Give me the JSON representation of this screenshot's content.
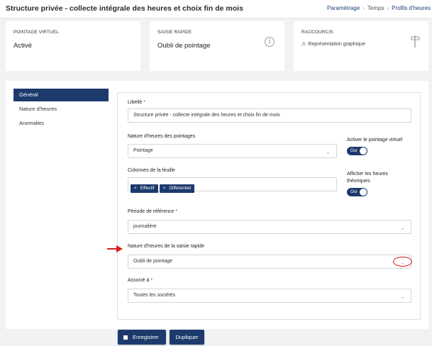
{
  "header": {
    "title": "Structure privée - collecte intégrale des heures et choix fin de mois",
    "breadcrumbs": [
      "Paramétrage",
      "Temps",
      "Profils d'heures"
    ]
  },
  "cards": {
    "pointage_virtuel": {
      "label": "POINTAGE VIRTUEL",
      "value": "Activé"
    },
    "saisie_rapide": {
      "label": "SAISIE RAPIDE",
      "value": "Oubli de pointage",
      "icon": "info-icon"
    },
    "raccourcis": {
      "label": "RACCOURCIS",
      "link_icon": "warning-icon",
      "link": "Représentation graphique",
      "icon": "signpost-icon"
    }
  },
  "nav": {
    "items": [
      {
        "label": "Général",
        "active": true
      },
      {
        "label": "Nature d'heures",
        "active": false
      },
      {
        "label": "Anomalies",
        "active": false
      }
    ]
  },
  "form": {
    "libelle": {
      "label": "Libellé",
      "required": "*",
      "value": "Structure privée - collecte intégrale des heures et choix fin de mois"
    },
    "nature_pointages": {
      "label": "Nature d'heures des pointages",
      "value": "Pointage"
    },
    "colonnes": {
      "label": "Colonnes de la feuille",
      "tags": [
        "Effectif",
        "Différentiel"
      ],
      "remove_glyph": "×"
    },
    "pointage_virtuel_toggle": {
      "label": "Activer le pointage virtuel",
      "state": "Oui"
    },
    "heures_theoriques_toggle": {
      "label_line1": "Afficher les heures",
      "label_line2": "théoriques",
      "state": "Oui"
    },
    "periode": {
      "label": "Période de référence",
      "required": "*",
      "value": "journalière"
    },
    "nature_saisie_rapide": {
      "label": "Nature d'heures de la saisie rapide",
      "value": "Oubli de pointage"
    },
    "associe": {
      "label": "Associé à",
      "required": "*",
      "value": "Toutes les sociétés"
    }
  },
  "buttons": {
    "save": "Enregistrer",
    "duplicate": "Dupliquer"
  },
  "colors": {
    "primary": "#1d3a6c",
    "annotation": "#d61d1d",
    "background": "#f1f2f4"
  }
}
